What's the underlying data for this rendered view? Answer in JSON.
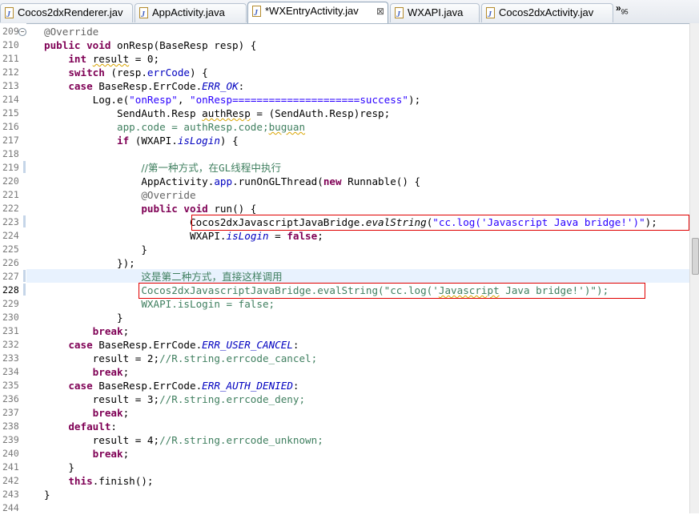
{
  "tabs": [
    {
      "label": "Cocos2dxRenderer.jav",
      "active": false
    },
    {
      "label": "AppActivity.java",
      "active": false
    },
    {
      "label": "*WXEntryActivity.jav",
      "active": true
    },
    {
      "label": "WXAPI.java",
      "active": false
    },
    {
      "label": "Cocos2dxActivity.jav",
      "active": false
    }
  ],
  "overflow": {
    "glyph": "»",
    "count": "95"
  },
  "line_numbers": [
    "209",
    "210",
    "211",
    "212",
    "213",
    "214",
    "215",
    "216",
    "217",
    "218",
    "219",
    "220",
    "221",
    "222",
    "223",
    "224",
    "225",
    "226",
    "227",
    "228",
    "229",
    "230",
    "231",
    "232",
    "233",
    "234",
    "235",
    "236",
    "237",
    "238",
    "239",
    "240",
    "241",
    "242",
    "243",
    "244"
  ],
  "code": {
    "l209": "@Override",
    "l210": [
      "public void",
      " onResp(BaseResp resp) {"
    ],
    "l211": [
      "int",
      " ",
      "result",
      " = 0;"
    ],
    "l212": [
      "switch",
      " (resp.",
      "errCode",
      ") {"
    ],
    "l213": [
      "case",
      " BaseResp.ErrCode.",
      "ERR_OK",
      ":"
    ],
    "l214": [
      "Log.e(",
      "\"onResp\"",
      ", ",
      "\"onResp=====================success\"",
      ");"
    ],
    "l215": [
      "SendAuth.Resp ",
      "authResp",
      " = (SendAuth.Resp)resp;"
    ],
    "l216": [
      "app.code = authResp.code;",
      "buguan"
    ],
    "l217": [
      "if",
      " (WXAPI.",
      "isLogin",
      ") {"
    ],
    "l218": "",
    "l219": [
      "//第一种方式，在",
      "GL",
      "线程中执行"
    ],
    "l220": [
      "AppActivity.",
      "app",
      ".runOnGLThread(",
      "new",
      " Runnable() {"
    ],
    "l221": "@Override",
    "l222": [
      "public void",
      " run() {"
    ],
    "l223": [
      "Cocos2dxJavascriptJavaBridge.",
      "evalString",
      "(",
      "\"cc.log('Javascript Java bridge!')\"",
      ");"
    ],
    "l224": [
      "WXAPI.",
      "isLogin",
      " = ",
      "false",
      ";"
    ],
    "l225": "}",
    "l226": "});",
    "l227": "这是第二种方式，直接这样调用",
    "l228": [
      "Cocos2dxJavascriptJavaBridge.evalString(\"cc.log('",
      "Javascript",
      " Java bridge!')\");"
    ],
    "l229": "WXAPI.isLogin = false;",
    "l230": "}",
    "l231": [
      "break",
      ";"
    ],
    "l232": [
      "case",
      " BaseResp.ErrCode.",
      "ERR_USER_CANCEL",
      ":"
    ],
    "l233": [
      "result = 2;",
      "//R.string.errcode_cancel;"
    ],
    "l234": [
      "break",
      ";"
    ],
    "l235": [
      "case",
      " BaseResp.ErrCode.",
      "ERR_AUTH_DENIED",
      ":"
    ],
    "l236": [
      "result = 3;",
      "//R.string.errcode_deny;"
    ],
    "l237": [
      "break",
      ";"
    ],
    "l238": [
      "default",
      ":"
    ],
    "l239": [
      "result = 4;",
      "//R.string.errcode_unknown;"
    ],
    "l240": [
      "break",
      ";"
    ],
    "l241": "}",
    "l242": [
      "this",
      ".finish();"
    ],
    "l243": "}",
    "l244": ""
  },
  "fold_markers": {
    "l209": "−"
  },
  "colors": {
    "keyword": "#7f0055",
    "string": "#2a00ff",
    "field": "#0000c0",
    "comment": "#3f7f5f",
    "annotation": "#646464",
    "highlight_box": "#e00000",
    "current_line": "#e8f2fe"
  }
}
